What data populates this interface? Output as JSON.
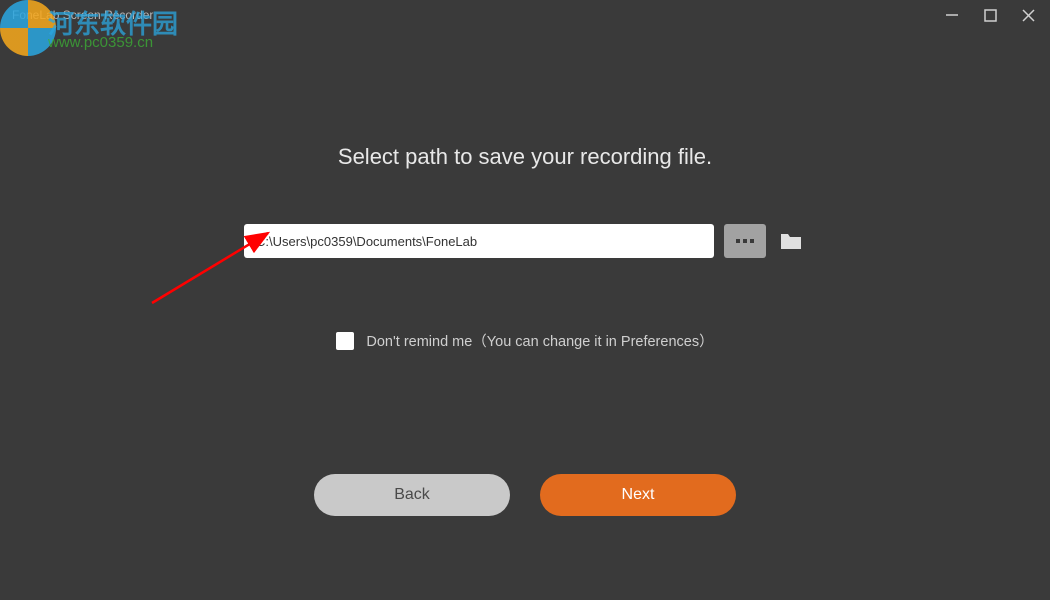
{
  "window": {
    "title": "FoneLab Screen Recorder"
  },
  "watermark": {
    "text": "河东软件园",
    "url": "www.pc0359.cn"
  },
  "main": {
    "heading": "Select path to save your recording file.",
    "path_value": "C:\\Users\\pc0359\\Documents\\FoneLab",
    "remind_label": "Don't remind me（You can change it in Preferences）"
  },
  "buttons": {
    "back": "Back",
    "next": "Next"
  }
}
